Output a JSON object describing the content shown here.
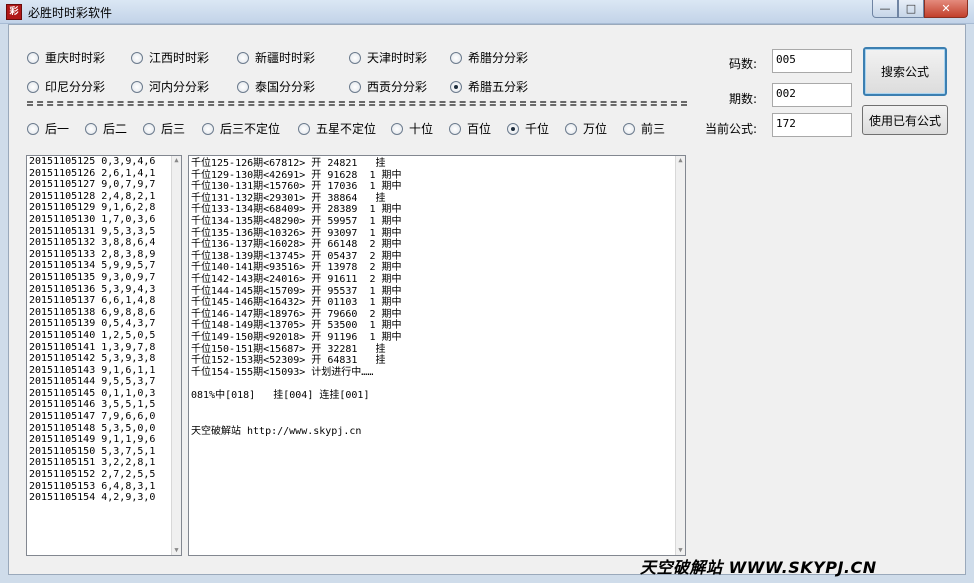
{
  "window": {
    "title": "必胜时时彩软件",
    "app_icon": "彩"
  },
  "lottery_options": [
    {
      "label": "重庆时时彩",
      "checked": false
    },
    {
      "label": "江西时时彩",
      "checked": false
    },
    {
      "label": "新疆时时彩",
      "checked": false
    },
    {
      "label": "天津时时彩",
      "checked": false
    },
    {
      "label": "希腊分分彩",
      "checked": false
    },
    {
      "label": "印尼分分彩",
      "checked": false
    },
    {
      "label": "河内分分彩",
      "checked": false
    },
    {
      "label": "泰国分分彩",
      "checked": false
    },
    {
      "label": "西贡分分彩",
      "checked": false
    },
    {
      "label": "希腊五分彩",
      "checked": true
    }
  ],
  "position_options": [
    {
      "label": "后一",
      "checked": false
    },
    {
      "label": "后二",
      "checked": false
    },
    {
      "label": "后三",
      "checked": false
    },
    {
      "label": "后三不定位",
      "checked": false
    },
    {
      "label": "五星不定位",
      "checked": false
    },
    {
      "label": "十位",
      "checked": false
    },
    {
      "label": "百位",
      "checked": false
    },
    {
      "label": "千位",
      "checked": true
    },
    {
      "label": "万位",
      "checked": false
    },
    {
      "label": "前三",
      "checked": false
    }
  ],
  "controls": {
    "code_count_label": "码数:",
    "code_count_value": "005",
    "period_count_label": "期数:",
    "period_count_value": "002",
    "current_formula_label": "当前公式:",
    "current_formula_value": "172",
    "search_button": "搜索公式",
    "use_existing_button": "使用已有公式"
  },
  "history": [
    "20151105125 0,3,9,4,6",
    "20151105126 2,6,1,4,1",
    "20151105127 9,0,7,9,7",
    "20151105128 2,4,8,2,1",
    "20151105129 9,1,6,2,8",
    "20151105130 1,7,0,3,6",
    "20151105131 9,5,3,3,5",
    "20151105132 3,8,8,6,4",
    "20151105133 2,8,3,8,9",
    "20151105134 5,9,9,5,7",
    "20151105135 9,3,0,9,7",
    "20151105136 5,3,9,4,3",
    "20151105137 6,6,1,4,8",
    "20151105138 6,9,8,8,6",
    "20151105139 0,5,4,3,7",
    "20151105140 1,2,5,0,5",
    "20151105141 1,3,9,7,8",
    "20151105142 5,3,9,3,8",
    "20151105143 9,1,6,1,1",
    "20151105144 9,5,5,3,7",
    "20151105145 0,1,1,0,3",
    "20151105146 3,5,5,1,5",
    "20151105147 7,9,6,6,0",
    "20151105148 5,3,5,0,0",
    "20151105149 9,1,1,9,6",
    "20151105150 5,3,7,5,1",
    "20151105151 3,2,2,8,1",
    "20151105152 2,7,2,5,5",
    "20151105153 6,4,8,3,1",
    "20151105154 4,2,9,3,0"
  ],
  "results": [
    "千位125-126期<67812> 开 24821   挂",
    "千位129-130期<42691> 开 91628  1 期中",
    "千位130-131期<15760> 开 17036  1 期中",
    "千位131-132期<29301> 开 38864   挂",
    "千位133-134期<68409> 开 28389  1 期中",
    "千位134-135期<48290> 开 59957  1 期中",
    "千位135-136期<10326> 开 93097  1 期中",
    "千位136-137期<16028> 开 66148  2 期中",
    "千位138-139期<13745> 开 05437  2 期中",
    "千位140-141期<93516> 开 13978  2 期中",
    "千位142-143期<24016> 开 91611  2 期中",
    "千位144-145期<15709> 开 95537  1 期中",
    "千位145-146期<16432> 开 01103  1 期中",
    "千位146-147期<18976> 开 79660  2 期中",
    "千位148-149期<13705> 开 53500  1 期中",
    "千位149-150期<92018> 开 91196  1 期中",
    "千位150-151期<15687> 开 32281   挂",
    "千位152-153期<52309> 开 64831   挂",
    "千位154-155期<15093> 计划进行中……"
  ],
  "summary": "081%中[018]   挂[004] 连挂[001]",
  "site_line": "天空破解站 http://www.skypj.cn",
  "watermark": "天空破解站 WWW.SKYPJ.CN"
}
